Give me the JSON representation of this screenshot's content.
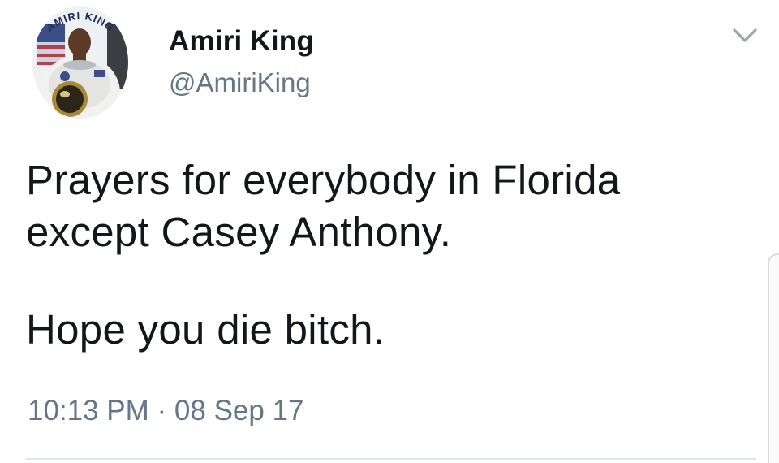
{
  "author": {
    "display_name": "Amiri King",
    "handle": "@AmiriKing",
    "avatar_caption": "AMIRI KING"
  },
  "tweet": {
    "lines": [
      "Prayers for everybody in Florida",
      "except Casey Anthony.",
      "Hope you die bitch."
    ],
    "timestamp": "10:13 PM · 08 Sep 17"
  },
  "icons": {
    "menu": "chevron-down-icon"
  },
  "colors": {
    "text": "#14171a",
    "secondary": "#657786",
    "divider": "#e1e8ed"
  }
}
